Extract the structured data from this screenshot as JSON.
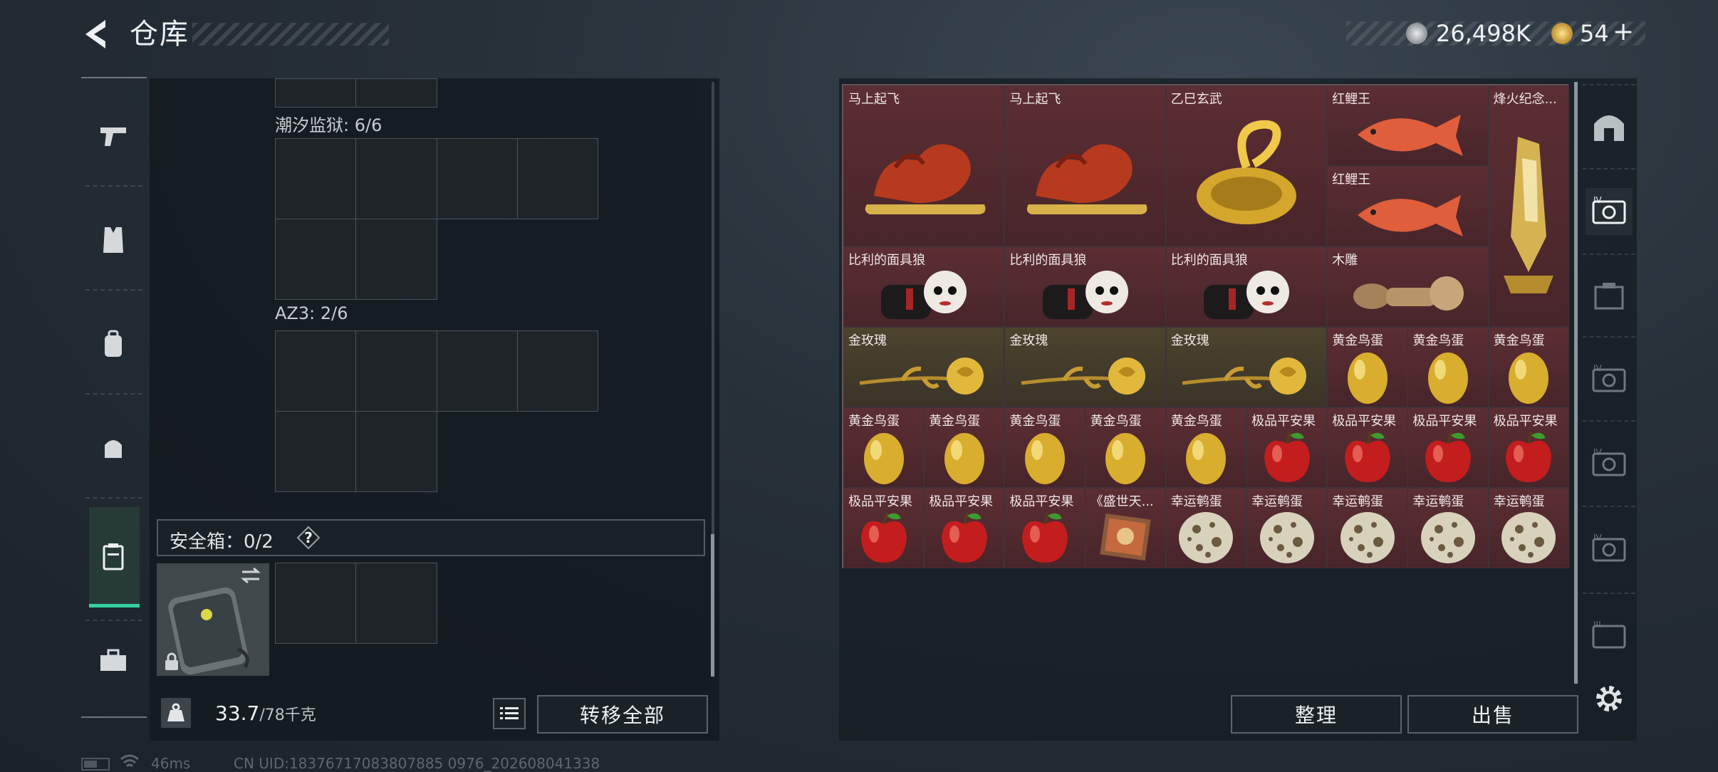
{
  "header": {
    "title": "仓库"
  },
  "currency": {
    "amount1": "26,498K",
    "amount2": "54",
    "plus": "+"
  },
  "colors": {
    "accent": "#33d1a1",
    "item_red": "#5c2e33",
    "item_gold": "#4d432e"
  },
  "sidebar": {
    "items": [
      "pistol-icon",
      "vest-icon",
      "backpack-icon",
      "chest-rig-icon",
      "safebox-icon",
      "toolbox-icon"
    ],
    "selected": 4
  },
  "left": {
    "sections": [
      {
        "label": "潮汐监狱: 6/6"
      },
      {
        "label": "AZ3: 2/6"
      }
    ],
    "safebox": {
      "label": "安全箱：0/2",
      "help": "?"
    },
    "weight": {
      "current": "33.7",
      "max": "/78千克"
    },
    "transfer_all": "转移全部"
  },
  "stash": {
    "items": [
      {
        "name": "马上起飞",
        "kind": "horse",
        "bg": "red"
      },
      {
        "name": "马上起飞",
        "kind": "horse",
        "bg": "red"
      },
      {
        "name": "乙巳玄武",
        "kind": "turtle",
        "bg": "red"
      },
      {
        "name": "红鲤王",
        "kind": "fish",
        "bg": "red"
      },
      {
        "name": "红鲤王",
        "kind": "fish",
        "bg": "red"
      },
      {
        "name": "烽火纪念...",
        "kind": "trophy",
        "bg": "red"
      },
      {
        "name": "比利的面具狼",
        "kind": "doll",
        "bg": "red"
      },
      {
        "name": "比利的面具狼",
        "kind": "doll",
        "bg": "red"
      },
      {
        "name": "比利的面具狼",
        "kind": "doll",
        "bg": "red"
      },
      {
        "name": "木雕",
        "kind": "carving",
        "bg": "red"
      },
      {
        "name": "金玫瑰",
        "kind": "rose",
        "bg": "gold"
      },
      {
        "name": "金玫瑰",
        "kind": "rose",
        "bg": "gold"
      },
      {
        "name": "金玫瑰",
        "kind": "rose",
        "bg": "gold"
      },
      {
        "name": "黄金鸟蛋",
        "kind": "goldegg",
        "bg": "red"
      },
      {
        "name": "黄金鸟蛋",
        "kind": "goldegg",
        "bg": "red"
      },
      {
        "name": "黄金鸟蛋",
        "kind": "goldegg",
        "bg": "red"
      },
      {
        "name": "黄金鸟蛋",
        "kind": "goldegg",
        "bg": "red"
      },
      {
        "name": "黄金鸟蛋",
        "kind": "goldegg",
        "bg": "red"
      },
      {
        "name": "黄金鸟蛋",
        "kind": "goldegg",
        "bg": "red"
      },
      {
        "name": "黄金鸟蛋",
        "kind": "goldegg",
        "bg": "red"
      },
      {
        "name": "黄金鸟蛋",
        "kind": "goldegg",
        "bg": "red"
      },
      {
        "name": "极品平安果",
        "kind": "apple",
        "bg": "red"
      },
      {
        "name": "极品平安果",
        "kind": "apple",
        "bg": "red"
      },
      {
        "name": "极品平安果",
        "kind": "apple",
        "bg": "red"
      },
      {
        "name": "极品平安果",
        "kind": "apple",
        "bg": "red"
      },
      {
        "name": "极品平安果",
        "kind": "apple",
        "bg": "red"
      },
      {
        "name": "极品平安果",
        "kind": "apple",
        "bg": "red"
      },
      {
        "name": "极品平安果",
        "kind": "apple",
        "bg": "red"
      },
      {
        "name": "《盛世天...",
        "kind": "painting",
        "bg": "red"
      },
      {
        "name": "幸运鹌蛋",
        "kind": "quail",
        "bg": "red"
      },
      {
        "name": "幸运鹌蛋",
        "kind": "quail",
        "bg": "red"
      },
      {
        "name": "幸运鹌蛋",
        "kind": "quail",
        "bg": "red"
      },
      {
        "name": "幸运鹌蛋",
        "kind": "quail",
        "bg": "red"
      },
      {
        "name": "幸运鹌蛋",
        "kind": "quail",
        "bg": "red"
      }
    ],
    "sort_label": "整理",
    "sell_label": "出售"
  },
  "right_tabs": [
    "vault-icon",
    "storage-iv-icon",
    "storage-box-icon",
    "storage-iv-icon",
    "storage-iv-icon",
    "storage-iv-icon",
    "storage-iii-icon",
    "settings-icon"
  ],
  "status": {
    "ping": "46ms",
    "uid": "CN UID:18376717083807885 0976_202608041338"
  }
}
